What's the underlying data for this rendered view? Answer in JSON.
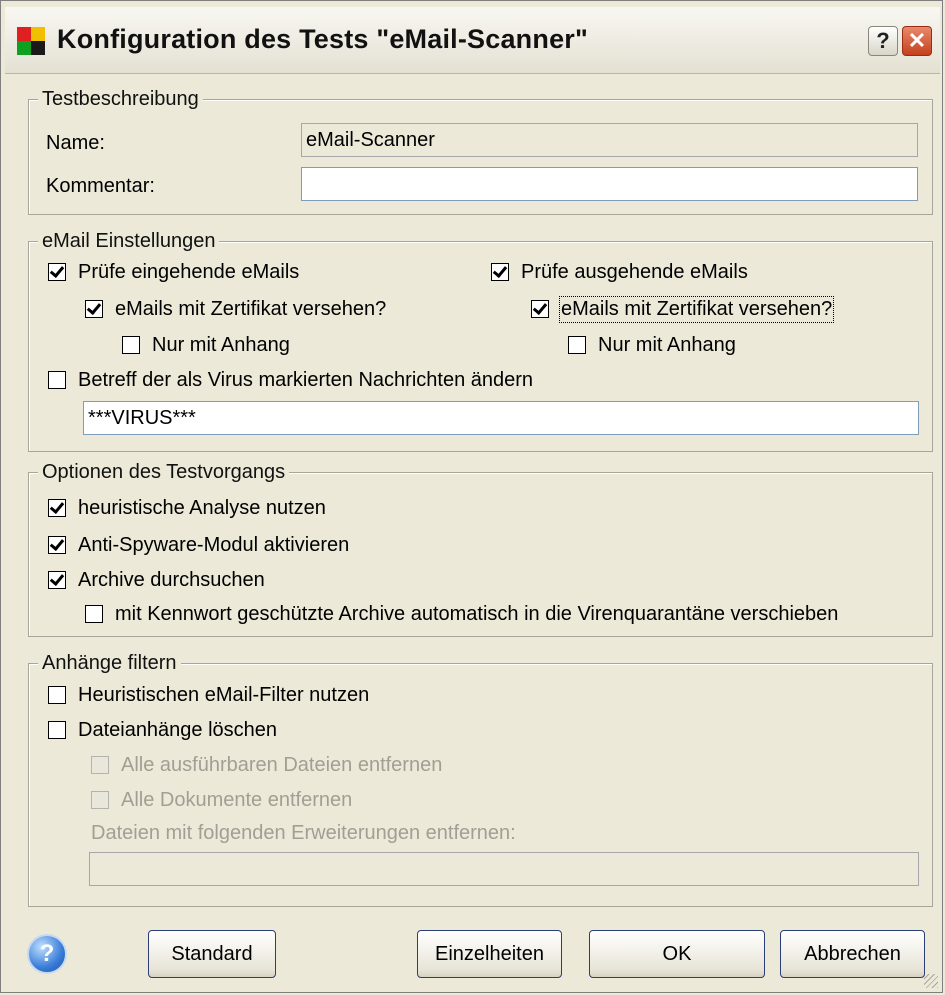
{
  "title": "Konfiguration des Tests \"eMail-Scanner\"",
  "titlebar_buttons": {
    "help": "?",
    "close": "✕"
  },
  "app_icon_colors": [
    "#e02020",
    "#f0c000",
    "#10a020",
    "#1a1a1a"
  ],
  "test_description": {
    "legend": "Testbeschreibung",
    "name_label": "Name:",
    "name_value": "eMail-Scanner",
    "comment_label": "Kommentar:",
    "comment_value": ""
  },
  "email_settings": {
    "legend": "eMail Einstellungen",
    "check_incoming": {
      "label": "Prüfe eingehende eMails",
      "checked": true
    },
    "incoming_certificate": {
      "label": "eMails mit Zertifikat versehen?",
      "checked": true
    },
    "incoming_attachment_only": {
      "label": "Nur mit Anhang",
      "checked": false
    },
    "check_outgoing": {
      "label": "Prüfe ausgehende eMails",
      "checked": true
    },
    "outgoing_certificate": {
      "label": "eMails mit Zertifikat versehen?",
      "checked": true
    },
    "outgoing_attachment_only": {
      "label": "Nur mit Anhang",
      "checked": false
    },
    "change_subject": {
      "label": "Betreff der als Virus markierten Nachrichten ändern",
      "checked": false
    },
    "subject_value": "***VIRUS***"
  },
  "scan_options": {
    "legend": "Optionen des Testvorgangs",
    "heuristic": {
      "label": "heuristische Analyse nutzen",
      "checked": true
    },
    "antispyware": {
      "label": "Anti-Spyware-Modul aktivieren",
      "checked": true
    },
    "archives": {
      "label": "Archive durchsuchen",
      "checked": true
    },
    "password_archives": {
      "label": "mit Kennwort geschützte Archive automatisch in die Virenquarantäne verschieben",
      "checked": false
    }
  },
  "attachment_filter": {
    "legend": "Anhänge filtern",
    "heuristic_filter": {
      "label": "Heuristischen eMail-Filter nutzen",
      "checked": false
    },
    "delete_attachments": {
      "label": "Dateianhänge löschen",
      "checked": false
    },
    "remove_executables": {
      "label": "Alle ausführbaren Dateien entfernen",
      "checked": false
    },
    "remove_documents": {
      "label": "Alle Dokumente entfernen",
      "checked": false
    },
    "extensions_label": "Dateien mit folgenden Erweiterungen entfernen:",
    "extensions_value": ""
  },
  "buttons": {
    "help": "?",
    "standard": "Standard",
    "details": "Einzelheiten",
    "ok": "OK",
    "cancel": "Abbrechen"
  }
}
